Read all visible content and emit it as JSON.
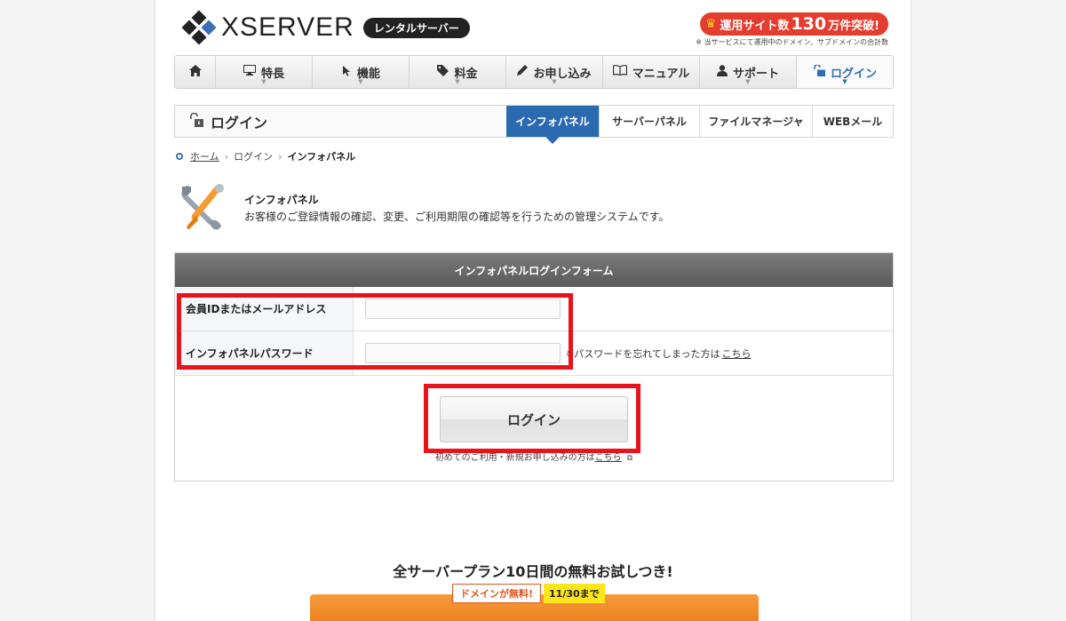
{
  "header": {
    "logo_text": "XSERVER",
    "logo_badge": "レンタルサーバー",
    "promo_prefix": "運用サイト数",
    "promo_number": "130",
    "promo_suffix": "万件突破!",
    "promo_note": "※ 当サービスにて運用中のドメイン、サブドメインの合計数"
  },
  "nav": {
    "items": [
      {
        "label": "",
        "icon": "home-icon"
      },
      {
        "label": "特長",
        "icon": "monitor-icon"
      },
      {
        "label": "機能",
        "icon": "cursor-icon"
      },
      {
        "label": "料金",
        "icon": "tag-icon"
      },
      {
        "label": "お申し込み",
        "icon": "pencil-icon"
      },
      {
        "label": "マニュアル",
        "icon": "book-icon"
      },
      {
        "label": "サポート",
        "icon": "person-icon"
      },
      {
        "label": "ログイン",
        "icon": "unlock-icon"
      }
    ]
  },
  "section": {
    "title": "ログイン",
    "tabs": [
      "インフォパネル",
      "サーバーパネル",
      "ファイルマネージャ",
      "WEBメール"
    ]
  },
  "breadcrumb": {
    "home": "ホーム",
    "login": "ログイン",
    "current": "インフォパネル"
  },
  "intro": {
    "title": "インフォパネル",
    "description": "お客様のご登録情報の確認、変更、ご利用期限の確認等を行うための管理システムです。"
  },
  "form": {
    "heading": "インフォパネルログインフォーム",
    "id_label": "会員IDまたはメールアドレス",
    "id_value": "",
    "password_label": "インフォパネルパスワード",
    "password_value": "",
    "forgot_text": "※パスワードを忘れてしまった方は",
    "forgot_link": "こちら",
    "login_button": "ログイン",
    "first_time_text": "初めてのご利用・新規お申し込みの方は",
    "first_time_link": "こちら"
  },
  "trial": {
    "title": "全サーバープラン10日間の無料お試しつき!",
    "domain_tag": "ドメインが無料!",
    "date_tag": "11/30まで"
  },
  "colors": {
    "accent_blue": "#2a6ab1",
    "highlight_red": "#e8131b",
    "promo_red": "#e43c2f",
    "cta_orange": "#ee7a13"
  }
}
